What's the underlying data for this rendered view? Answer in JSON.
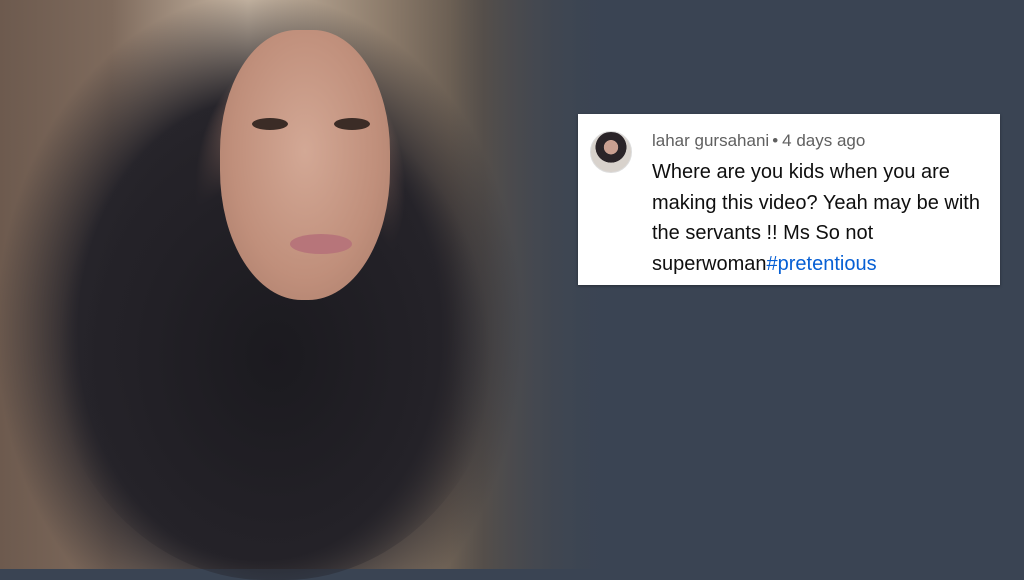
{
  "comment": {
    "author": "lahar gursahani",
    "separator": "•",
    "time": "4 days ago",
    "lines": [
      "Where are you kids when you are",
      "making this video? Yeah may be with",
      "the servants !! Ms So not",
      "superwoman"
    ],
    "hashtag": "#pretentious"
  },
  "colors": {
    "background": "#3a4453",
    "hashtag": "#065fd4",
    "meta_text": "#606060"
  },
  "icons": {
    "avatar": "user-avatar"
  }
}
